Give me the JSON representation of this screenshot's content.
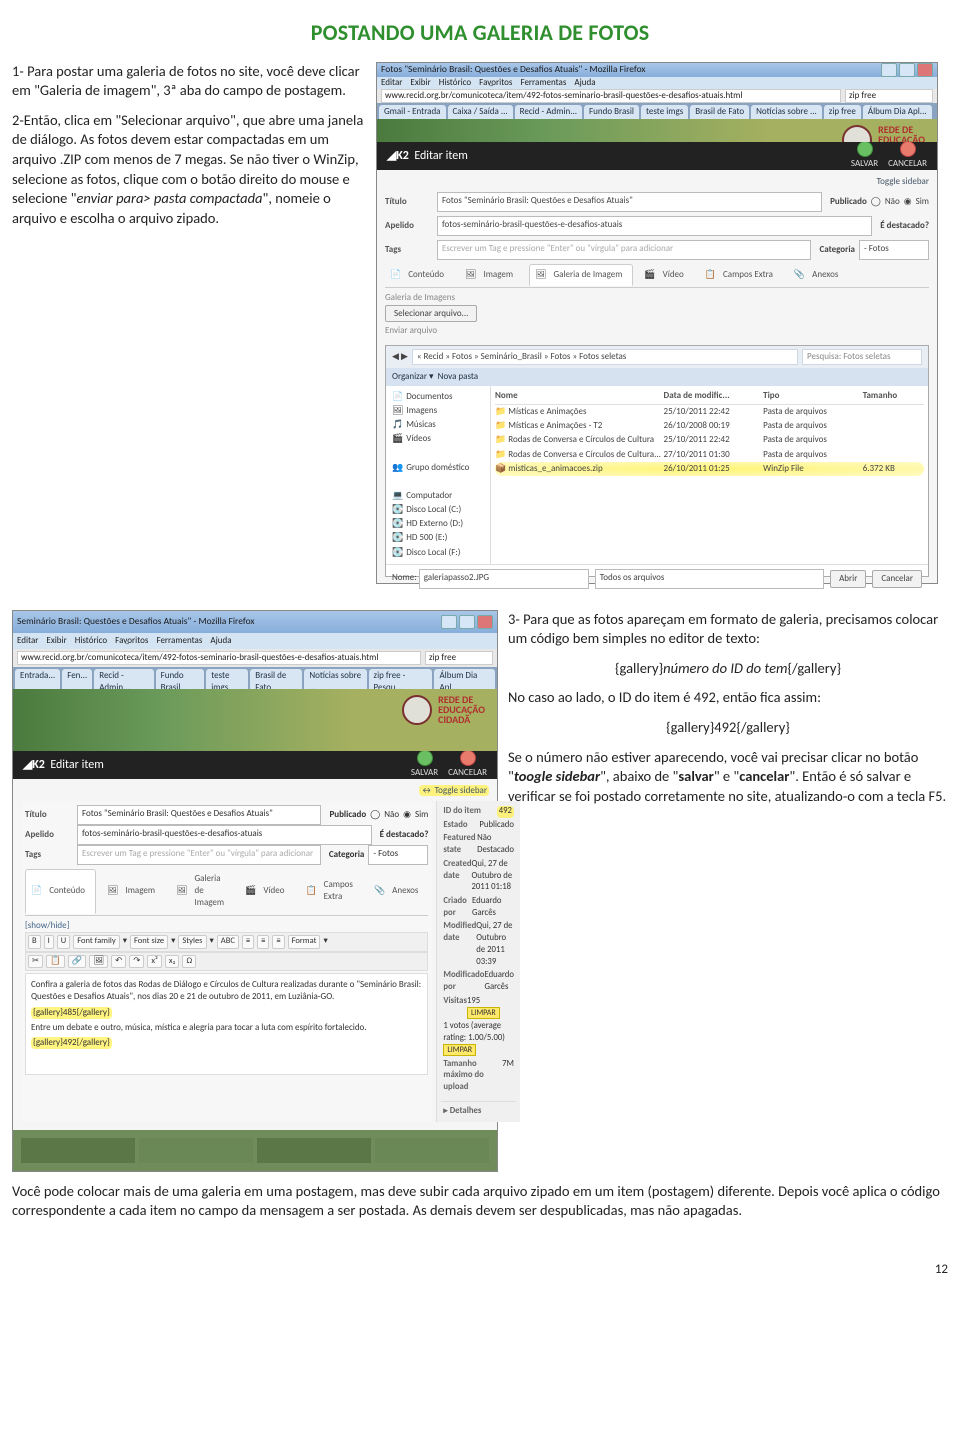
{
  "title": "POSTANDO UMA GALERIA DE FOTOS",
  "step1": "1- Para postar uma galeria de fotos no site, você deve clicar em \"Galeria de imagem\", 3ª aba do campo de postagem.",
  "step2_a": "2-Então, clica em \"Selecionar arquivo\", que abre uma janela de diálogo. As fotos devem estar compactadas em um arquivo .ZIP com menos de 7 megas. Se não tiver o WinZip, selecione as fotos, clique com o botão direito do mouse e selecione \"",
  "step2_em": "enviar para> pasta compactada",
  "step2_b": "\", nomeie o arquivo e escolha o arquivo zipado.",
  "step3": "3- Para que as fotos apareçam em formato de galeria, precisamos colocar um código bem simples no editor de texto:",
  "code_template_a": "{gallery}",
  "code_template_em": "número do ID do tem",
  "code_template_b": "{/gallery}",
  "step4": "No caso ao lado, o ID do item é 492, então fica assim:",
  "code_example": "{gallery}492{/gallery}",
  "step5_a": "Se o número não estiver aparecendo, você vai precisar clicar no botão \"",
  "step5_b1": "toogle sidebar",
  "step5_b": "\", abaixo de \"",
  "step5_b2": "salvar",
  "step5_c": "\" e \"",
  "step5_b3": "cancelar",
  "step5_d": "\". Então é só salvar e verificar se foi postado corretamente no site, atualizando-o com a tecla F5.",
  "final": "Você pode colocar mais de uma galeria em uma postagem, mas deve subir cada arquivo zipado em um item (postagem) diferente. Depois você aplica o código correspondente a cada item no campo da mensagem a ser postada. As demais devem ser despublicadas, mas não apagadas.",
  "pagenum": "12",
  "shot1": {
    "windowtitle": "Fotos \"Seminário Brasil: Questões e Desafios Atuais\" - Mozilla Firefox",
    "url": "www.recid.org.br/comunicoteca/item/492-fotos-seminario-brasil-questões-e-desafios-atuais.html",
    "menus": [
      "Editar",
      "Exibir",
      "Histórico",
      "Fav̲oritos",
      "Ferramentas",
      "Ajuda"
    ],
    "tabs": [
      "Gmail - Entrada",
      "Caixa / Saída ...",
      "Recid - Admin...",
      "Fundo Brasil",
      "teste imgs",
      "Brasil de Fato",
      "Notícias sobre ...",
      "zip free",
      "Álbum Dia Apl..."
    ],
    "banner_logo": "REDE DE\nEDUCAÇÃO\nCIDADÃ",
    "k2_editar": "Editar item",
    "k2_salvar": "SALVAR",
    "k2_cancelar": "CANCELAR",
    "toggle": "Toggle sidebar",
    "fields": {
      "titulo_label": "Título",
      "titulo": "Fotos \"Seminário Brasil: Questões e Desafios Atuais\"",
      "pub_label": "Publicado",
      "nao": "Não",
      "sim": "Sim",
      "apelido_label": "Apelido",
      "apelido": "fotos-seminário-brasil-questões-e-desafios-atuais",
      "dest_label": "É destacado?",
      "tags_label": "Tags",
      "tags_hint": "Escrever um Tag e pressione \"Enter\" ou \"vírgula\" para adicionar",
      "cat_label": "Categoria",
      "cat_val": "- Fotos"
    },
    "tabs2": [
      "Conteúdo",
      "Imagem",
      "Galeria de Imagem",
      "Vídeo",
      "Campos Extra",
      "Anexos"
    ],
    "gallery_label": "Galeria de Imagens",
    "selecionar": "Selecionar arquivo...",
    "enviar": "Enviar arquivo",
    "dialog": {
      "path": "« Recid » Fotos » Seminário_Brasil » Fotos » Fotos seletas",
      "search": "Pesquisa: Fotos seletas",
      "organizar": "Organizar",
      "nova": "Nova pasta",
      "sidebar": [
        "Documentos",
        "Imagens",
        "Músicas",
        "Vídeos",
        "",
        "Grupo doméstico",
        "",
        "Computador",
        "Disco Local (C:)",
        "HD Externo (D:)",
        "HD 500 (E:)",
        "Disco Local (F:)"
      ],
      "cols": [
        "Nome",
        "Data de modific...",
        "Tipo",
        "Tamanho"
      ],
      "rows": [
        {
          "name": "Místicas e Animações",
          "date": "25/10/2011 22:42",
          "type": "Pasta de arquivos",
          "size": ""
        },
        {
          "name": "Místicas e Animações - T2",
          "date": "26/10/2008 00:19",
          "type": "Pasta de arquivos",
          "size": ""
        },
        {
          "name": "Rodas de Conversa e Círculos de Cultura",
          "date": "25/10/2011 22:42",
          "type": "Pasta de arquivos",
          "size": ""
        },
        {
          "name": "Rodas de Conversa e Círculos de Cultura...",
          "date": "27/10/2011 01:30",
          "type": "Pasta de arquivos",
          "size": ""
        },
        {
          "name": "misticas_e_animacoes.zip",
          "date": "26/10/2011 01:25",
          "type": "WinZip File",
          "size": "6.372 KB"
        }
      ],
      "filename_label": "Nome:",
      "filename": "galeriapasso2.JPG",
      "alltypes": "Todos os arquivos",
      "abrir": "Abrir",
      "cancelar": "Cancelar"
    }
  },
  "shot2": {
    "windowtitle": "Seminário Brasil: Questões e Desafios Atuais\" - Mozilla Firefox",
    "url": "www.recid.org.br/comunicoteca/item/492-fotos-seminario-brasil-questões-e-desafios-atuais.html",
    "menus": [
      "Editar",
      "Exibir",
      "Histórico",
      "Fav̲oritos",
      "Ferramentas",
      "Ajuda"
    ],
    "tabs": [
      "Entrada...",
      "Fen...",
      "Recid - Admin...",
      "Fundo Brasil",
      "teste imgs",
      "Brasil de Fato",
      "Notícias sobre ...",
      "zip free - Pesqu...",
      "Álbum Dia Apl..."
    ],
    "banner_logo": "REDE DE\nEDUCAÇÃO\nCIDADÃ",
    "k2_editar": "Editar item",
    "k2_salvar": "SALVAR",
    "k2_cancelar": "CANCELAR",
    "toggle": "Toggle sidebar",
    "fields": {
      "titulo_label": "Título",
      "titulo": "Fotos \"Seminário Brasil: Questões e Desafios Atuais\"",
      "pub_label": "Publicado",
      "nao": "Não",
      "sim": "Sim",
      "apelido_label": "Apelido",
      "apelido": "fotos-seminário-brasil-questões-e-desafios-atuais",
      "dest_label": "É destacado?",
      "tags_label": "Tags",
      "tags_hint": "Escrever um Tag e pressione \"Enter\" ou \"vírgula\" para adicionar",
      "cat_label": "Categoria",
      "cat_val": "- Fotos"
    },
    "tabs2": [
      "Conteúdo",
      "Imagem",
      "Galeria de Imagem",
      "Vídeo",
      "Campos Extra",
      "Anexos"
    ],
    "side": {
      "id_l": "ID do item",
      "id_v": "492",
      "est_l": "Estado",
      "est_v": "Publicado",
      "fs_l": "Featured state",
      "fs_v": "Não Destacado",
      "cd_l": "Created date",
      "cd_v": "Qui, 27 de Outubro de 2011 01:18",
      "cp_l": "Criado por",
      "cp_v": "Eduardo Garcês",
      "md_l": "Modified date",
      "md_v": "Qui, 27 de Outubro de 2011 03:39",
      "mp_l": "Modificado por",
      "mp_v": "Eduardo Garcês",
      "vis_l": "Visitas",
      "vis_v": "195",
      "limpar": "LIMPAR",
      "votos": "1 votos (average rating: 1.00/5.00)",
      "tam_l": "Tamanho máximo do upload",
      "tam_v": "7M",
      "det": "Detalhes"
    },
    "editor": {
      "showhide": "[show/hide]",
      "fontfamily": "Font family",
      "fontsize": "Font size",
      "styles": "Styles",
      "format": "Format",
      "body1": "Confira a galeria de fotos das Rodas de Diálogo e Círculos de Cultura realizadas durante o \"Seminário Brasil: Questões e Desafios Atuais\", nos dias 20 e 21 de outubro de 2011, em Luziânia-GO.",
      "code1": "{gallery}485{/gallery}",
      "body2": "Entre um debate e outro, música, mística e alegria para tocar a luta com espírito fortalecido.",
      "code2": "{gallery}492{/gallery}"
    }
  }
}
